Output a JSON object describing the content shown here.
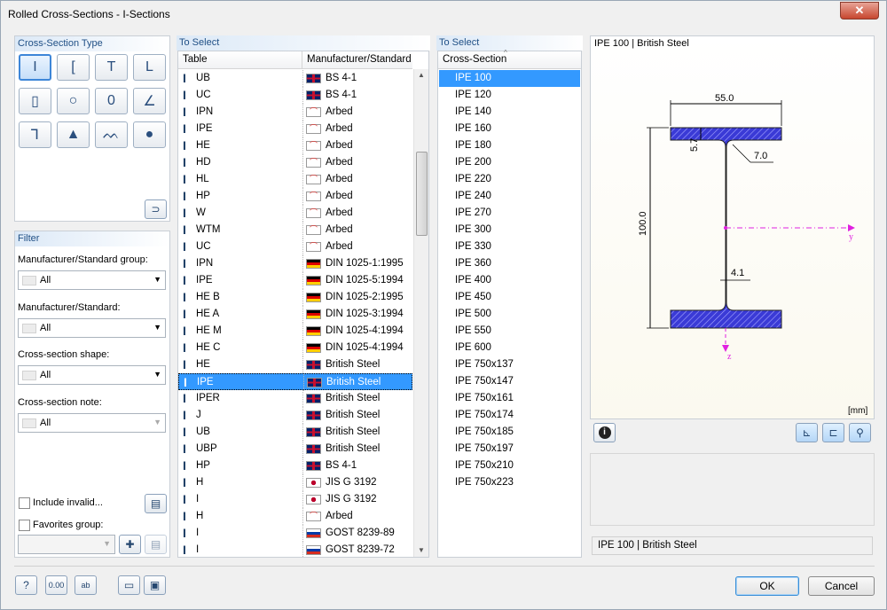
{
  "window": {
    "title": "Rolled Cross-Sections - I-Sections",
    "close_icon": "close-icon"
  },
  "type_panel": {
    "title": "Cross-Section Type"
  },
  "filter": {
    "title": "Filter",
    "groups": [
      {
        "label": "Manufacturer/Standard group:",
        "value": "All"
      },
      {
        "label": "Manufacturer/Standard:",
        "value": "All"
      },
      {
        "label": "Cross-section shape:",
        "value": "All"
      },
      {
        "label": "Cross-section note:",
        "value": "All"
      }
    ],
    "include_invalid": "Include invalid...",
    "favorites_group": "Favorites group:"
  },
  "table_panel": {
    "title": "To Select",
    "col_table": "Table",
    "col_manufacturer": "Manufacturer/Standard",
    "rows": [
      {
        "table": "UB",
        "mfr": "BS 4-1",
        "flag": "uk"
      },
      {
        "table": "UC",
        "mfr": "BS 4-1",
        "flag": "uk"
      },
      {
        "table": "IPN",
        "mfr": "Arbed",
        "flag": "arbed"
      },
      {
        "table": "IPE",
        "mfr": "Arbed",
        "flag": "arbed"
      },
      {
        "table": "HE",
        "mfr": "Arbed",
        "flag": "arbed"
      },
      {
        "table": "HD",
        "mfr": "Arbed",
        "flag": "arbed"
      },
      {
        "table": "HL",
        "mfr": "Arbed",
        "flag": "arbed"
      },
      {
        "table": "HP",
        "mfr": "Arbed",
        "flag": "arbed"
      },
      {
        "table": "W",
        "mfr": "Arbed",
        "flag": "arbed"
      },
      {
        "table": "WTM",
        "mfr": "Arbed",
        "flag": "arbed"
      },
      {
        "table": "UC",
        "mfr": "Arbed",
        "flag": "arbed"
      },
      {
        "table": "IPN",
        "mfr": "DIN 1025-1:1995",
        "flag": "de"
      },
      {
        "table": "IPE",
        "mfr": "DIN 1025-5:1994",
        "flag": "de"
      },
      {
        "table": "HE B",
        "mfr": "DIN 1025-2:1995",
        "flag": "de"
      },
      {
        "table": "HE A",
        "mfr": "DIN 1025-3:1994",
        "flag": "de"
      },
      {
        "table": "HE M",
        "mfr": "DIN 1025-4:1994",
        "flag": "de"
      },
      {
        "table": "HE C",
        "mfr": "DIN 1025-4:1994",
        "flag": "de"
      },
      {
        "table": "HE",
        "mfr": "British Steel",
        "flag": "uk"
      },
      {
        "table": "IPE",
        "mfr": "British Steel",
        "flag": "uk",
        "selected": true
      },
      {
        "table": "IPER",
        "mfr": "British Steel",
        "flag": "uk"
      },
      {
        "table": "J",
        "mfr": "British Steel",
        "flag": "uk"
      },
      {
        "table": "UB",
        "mfr": "British Steel",
        "flag": "uk"
      },
      {
        "table": "UBP",
        "mfr": "British Steel",
        "flag": "uk"
      },
      {
        "table": "HP",
        "mfr": "BS 4-1",
        "flag": "uk"
      },
      {
        "table": "H",
        "mfr": "JIS G 3192",
        "flag": "jp"
      },
      {
        "table": "I",
        "mfr": "JIS G 3192",
        "flag": "jp"
      },
      {
        "table": "H",
        "mfr": "Arbed",
        "flag": "arbed"
      },
      {
        "table": "I",
        "mfr": "GOST 8239-89",
        "flag": "ru"
      },
      {
        "table": "I",
        "mfr": "GOST 8239-72",
        "flag": "ru"
      }
    ]
  },
  "section_panel": {
    "title": "To Select",
    "col": "Cross-Section",
    "rows": [
      "IPE 100",
      "IPE 120",
      "IPE 140",
      "IPE 160",
      "IPE 180",
      "IPE 200",
      "IPE 220",
      "IPE 240",
      "IPE 270",
      "IPE 300",
      "IPE 330",
      "IPE 360",
      "IPE 400",
      "IPE 450",
      "IPE 500",
      "IPE 550",
      "IPE 600",
      "IPE 750x137",
      "IPE 750x147",
      "IPE 750x161",
      "IPE 750x174",
      "IPE 750x185",
      "IPE 750x197",
      "IPE 750x210",
      "IPE 750x223"
    ],
    "selected_index": 0
  },
  "preview": {
    "title": "IPE 100 | British Steel",
    "dim_width": "55.0",
    "dim_height": "100.0",
    "dim_flange": "5.7",
    "dim_radius": "7.0",
    "dim_web": "4.1",
    "axis_y": "y",
    "axis_z": "z",
    "unit": "[mm]",
    "status": "IPE 100 | British Steel"
  },
  "buttons": {
    "ok": "OK",
    "cancel": "Cancel"
  },
  "colors": {
    "accent": "#3399ff",
    "hatch": "#3a3ad6",
    "axis": "#e020e0"
  }
}
